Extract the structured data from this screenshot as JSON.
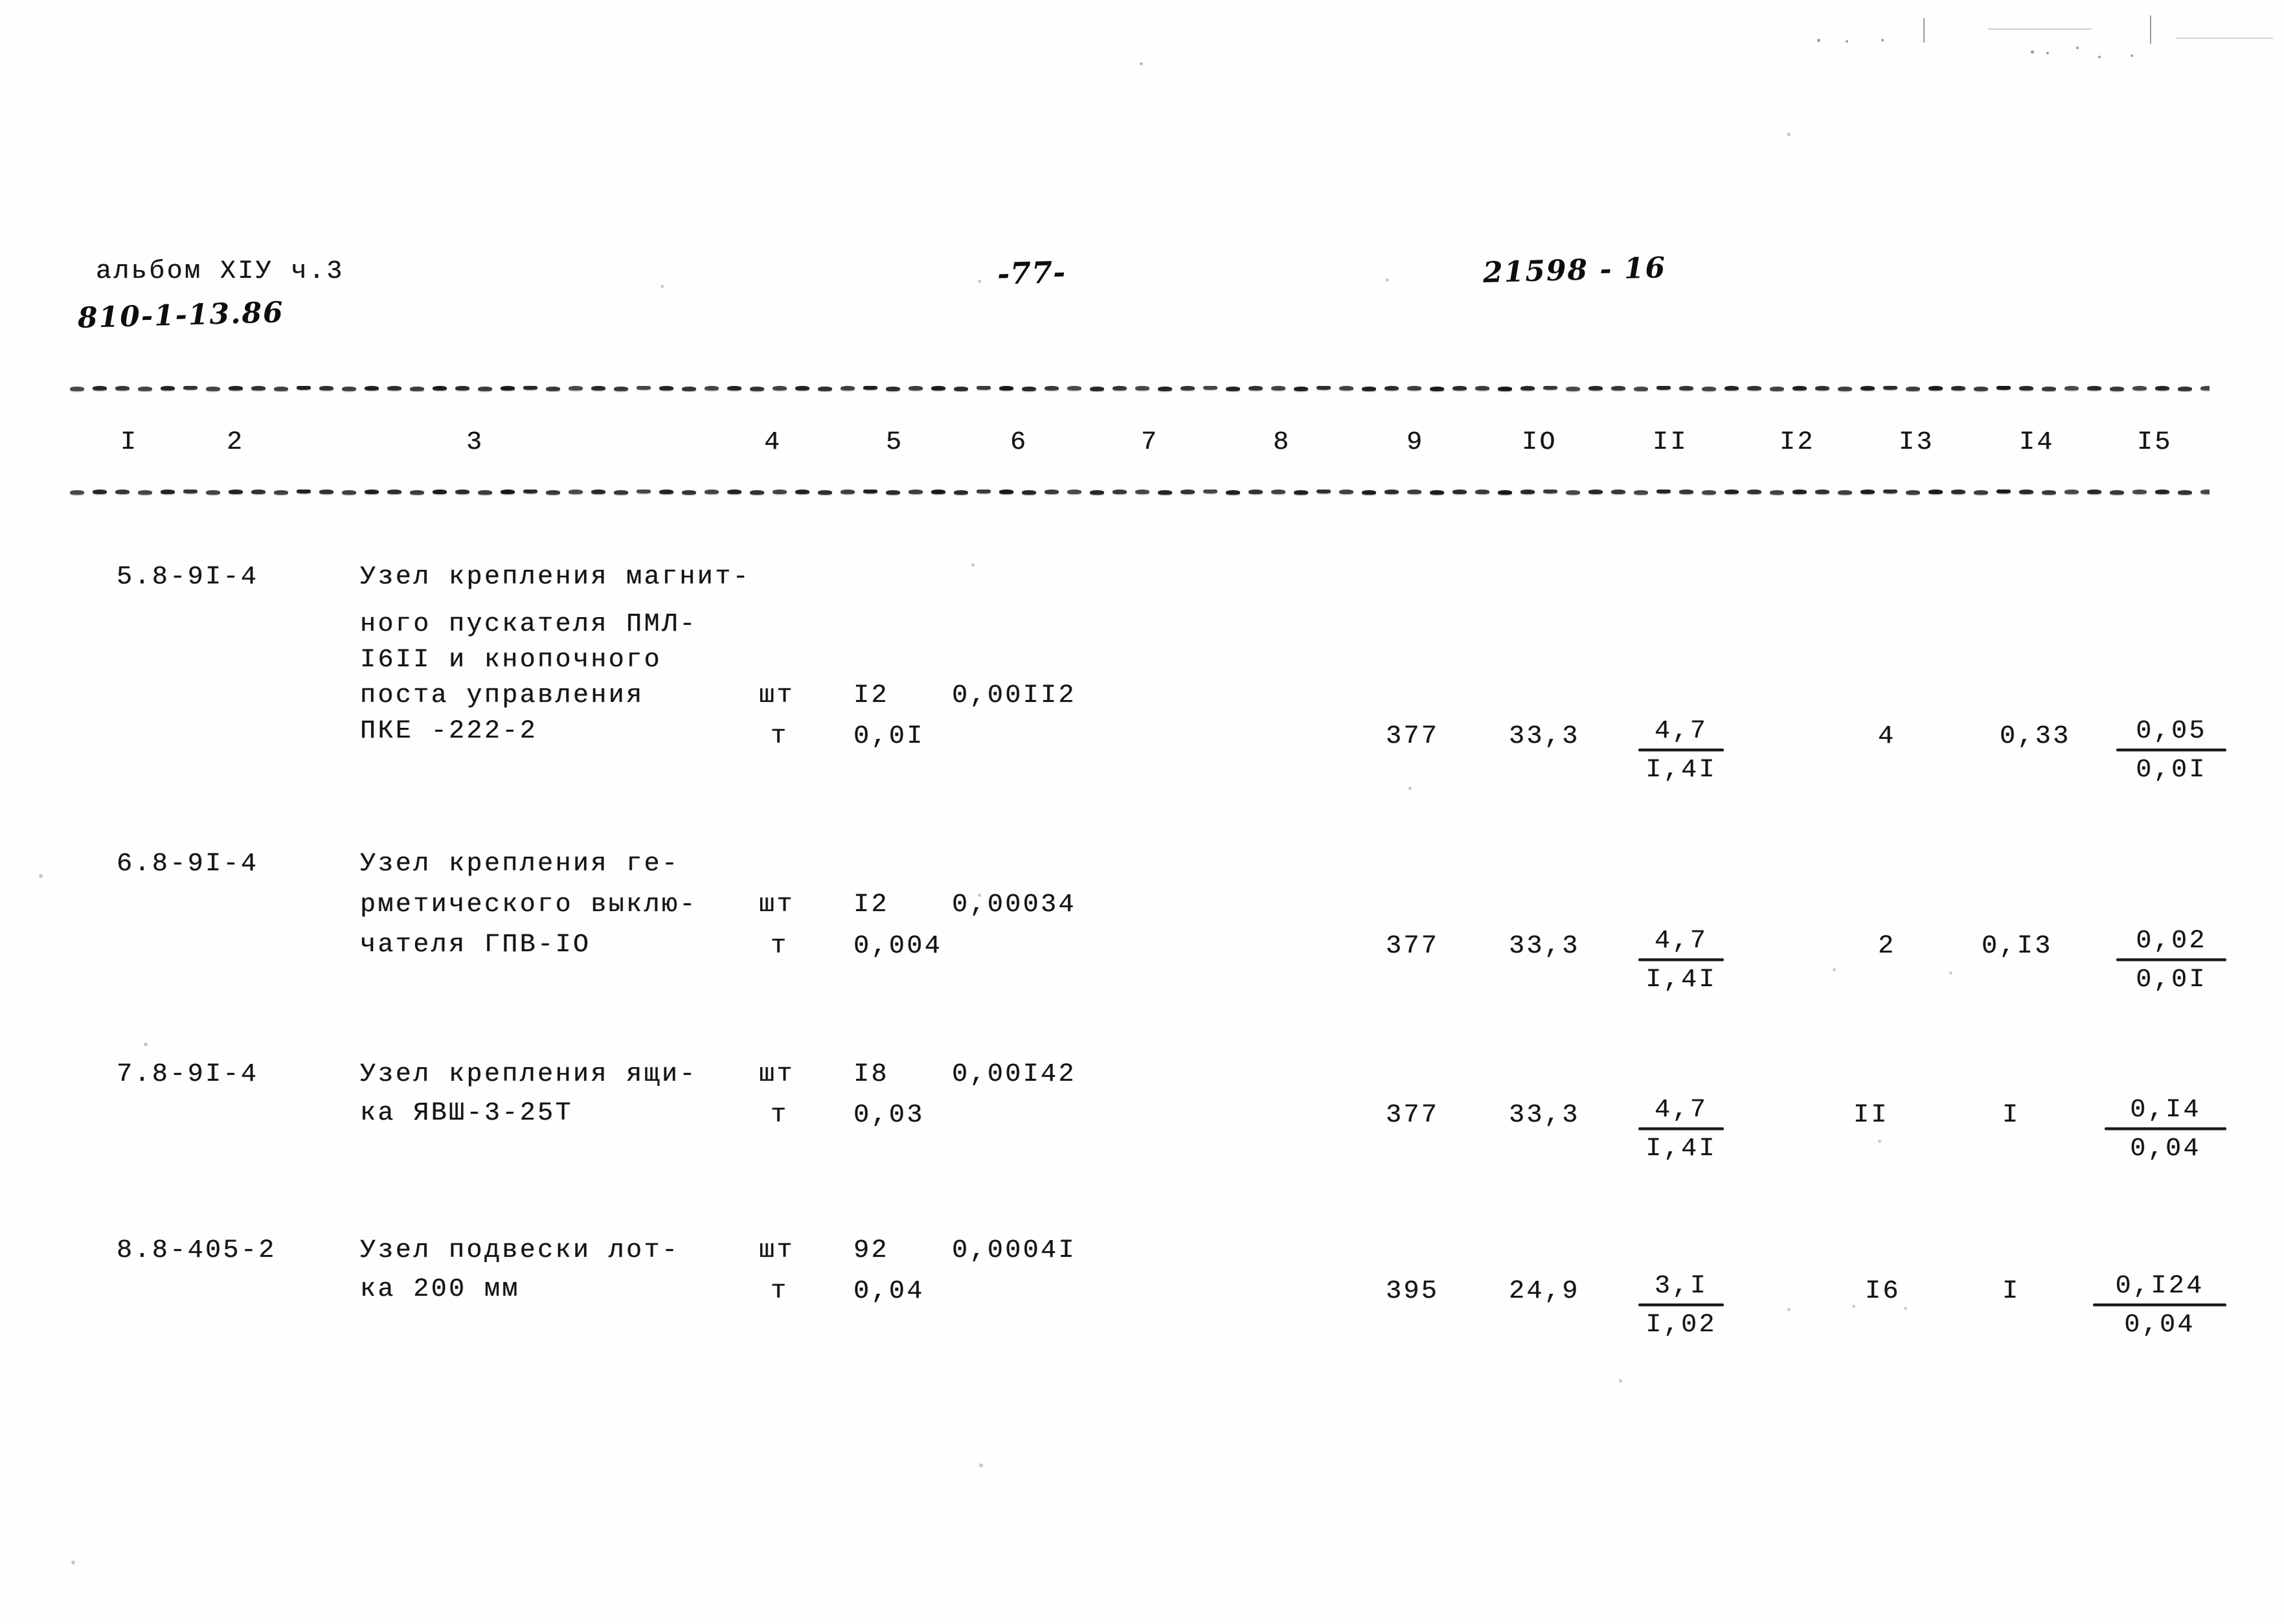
{
  "document": {
    "header": {
      "album_label": "альбом ХIУ ч.3",
      "album_code": "810-1-13.86",
      "page_number": "-77-",
      "doc_code": "21598 - 16"
    },
    "table": {
      "column_numbers": [
        "I",
        "2",
        "3",
        "4",
        "5",
        "6",
        "7",
        "8",
        "9",
        "IO",
        "II",
        "I2",
        "I3",
        "I4",
        "I5"
      ],
      "rows": [
        {
          "code": "5.8-9I-4",
          "description_lines": [
            "Узел крепления магнит-",
            "ного пускателя ПМЛ-",
            "I6II и кнопочного",
            "поста управления",
            "ПКЕ -222-2"
          ],
          "unit_1": "шт",
          "qty_1": "I2",
          "value_1": "0,00II2",
          "unit_2": "т",
          "qty_2": "0,0I",
          "col7": "",
          "col8": "",
          "col9": "377",
          "col10": "33,3",
          "col11_num": "4,7",
          "col11_den": "I,4I",
          "col12": "4",
          "col13": "",
          "col14": "0,33",
          "col15_num": "0,05",
          "col15_den": "0,0I"
        },
        {
          "code": "6.8-9I-4",
          "description_lines": [
            "Узел крепления ге-",
            "рметического выклю-",
            "чателя ГПВ-IO"
          ],
          "unit_1": "шт",
          "qty_1": "I2",
          "value_1": "0,00034",
          "unit_2": "т",
          "qty_2": "0,004",
          "col7": "",
          "col8": "",
          "col9": "377",
          "col10": "33,3",
          "col11_num": "4,7",
          "col11_den": "I,4I",
          "col12": "2",
          "col13": "",
          "col14": "0,I3",
          "col15_num": "0,02",
          "col15_den": "0,0I"
        },
        {
          "code": "7.8-9I-4",
          "description_lines": [
            "Узел крепления ящи-",
            "ка ЯВШ-3-25Т"
          ],
          "unit_1": "шт",
          "qty_1": "I8",
          "value_1": "0,00I42",
          "unit_2": "т",
          "qty_2": "0,03",
          "col7": "",
          "col8": "",
          "col9": "377",
          "col10": "33,3",
          "col11_num": "4,7",
          "col11_den": "I,4I",
          "col12": "II",
          "col13": "",
          "col14": "I",
          "col15_num": "0,I4",
          "col15_den": "0,04"
        },
        {
          "code": "8.8-405-2",
          "description_lines": [
            "Узел подвески лот-",
            "ка 200 мм"
          ],
          "unit_1": "шт",
          "qty_1": "92",
          "value_1": "0,0004I",
          "unit_2": "т",
          "qty_2": "0,04",
          "col7": "",
          "col8": "",
          "col9": "395",
          "col10": "24,9",
          "col11_num": "3,I",
          "col11_den": "I,02",
          "col12": "I6",
          "col13": "",
          "col14": "I",
          "col15_num": "0,I24",
          "col15_den": "0,04"
        }
      ]
    }
  }
}
